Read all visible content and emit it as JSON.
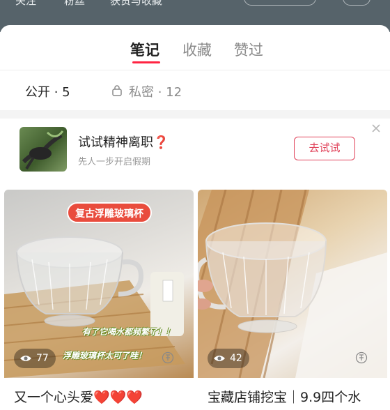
{
  "header": {
    "stats_cut": [
      "关注",
      "粉丝",
      "获赞与收藏"
    ]
  },
  "tabs": [
    {
      "label": "笔记",
      "active": true
    },
    {
      "label": "收藏",
      "active": false
    },
    {
      "label": "赞过",
      "active": false
    }
  ],
  "filters": {
    "public": "公开 · 5",
    "private": "私密 · 12"
  },
  "promo": {
    "title": "试试精神离职❓",
    "subtitle": "先人一步开启假期",
    "button": "去试试"
  },
  "cards": [
    {
      "sticker": "复古浮雕玻璃杯",
      "caption1": "有了它喝水都频繁了！！",
      "caption2": "浮雕玻璃杯太可了哇！",
      "views": "77",
      "title": "又一个心头爱❤️❤️❤️"
    },
    {
      "views": "42",
      "title": "宝藏店铺挖宝｜9.9四个水"
    }
  ],
  "colors": {
    "accent": "#ff2442",
    "button_red": "#e04058",
    "header_bg": "#56636a"
  }
}
